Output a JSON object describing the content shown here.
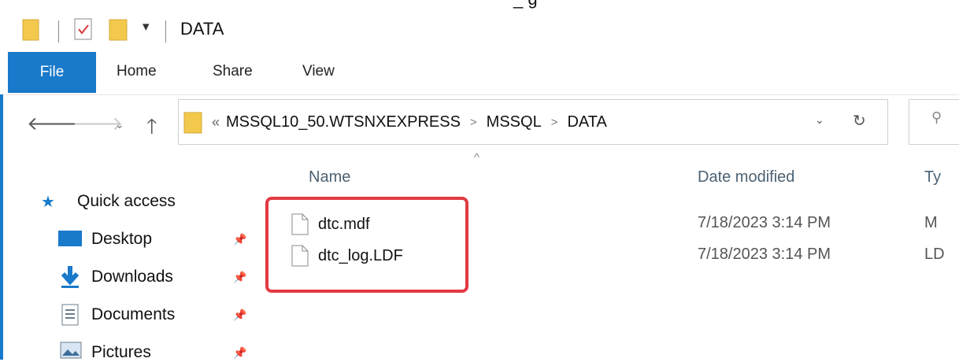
{
  "cropped_header_text": "_ g",
  "window": {
    "title": "DATA",
    "qa_dropdown_icon": "chevron-down-icon"
  },
  "ribbon": {
    "tabs": [
      "File",
      "Home",
      "Share",
      "View"
    ]
  },
  "nav": {
    "back_icon": "arrow-left-icon",
    "forward_icon": "arrow-right-icon",
    "recent_icon": "chevron-down-icon",
    "up_icon": "arrow-up-icon"
  },
  "address": {
    "overflow": "«",
    "crumbs": [
      "MSSQL10_50.WTSNXEXPRESS",
      "MSSQL",
      "DATA"
    ],
    "separator": ">",
    "dropdown_icon": "chevron-down-icon",
    "refresh_icon": "refresh-icon"
  },
  "search": {
    "icon": "search-icon"
  },
  "sidebar": {
    "items": [
      {
        "label": "Quick access",
        "icon": "star-icon"
      },
      {
        "label": "Desktop",
        "icon": "desktop-icon",
        "pinned": true
      },
      {
        "label": "Downloads",
        "icon": "download-icon",
        "pinned": true
      },
      {
        "label": "Documents",
        "icon": "documents-icon",
        "pinned": true
      },
      {
        "label": "Pictures",
        "icon": "pictures-icon",
        "pinned": true
      }
    ]
  },
  "file_list": {
    "sort_indicator": "^",
    "columns": [
      "Name",
      "Date modified",
      "Ty"
    ],
    "rows": [
      {
        "name": "dtc.mdf",
        "date": "7/18/2023 3:14 PM",
        "type": "M"
      },
      {
        "name": "dtc_log.LDF",
        "date": "7/18/2023 3:14 PM",
        "type": "LD"
      }
    ]
  },
  "colors": {
    "accent": "#1979ca",
    "highlight": "#e23a43",
    "folder": "#f2c94c"
  }
}
